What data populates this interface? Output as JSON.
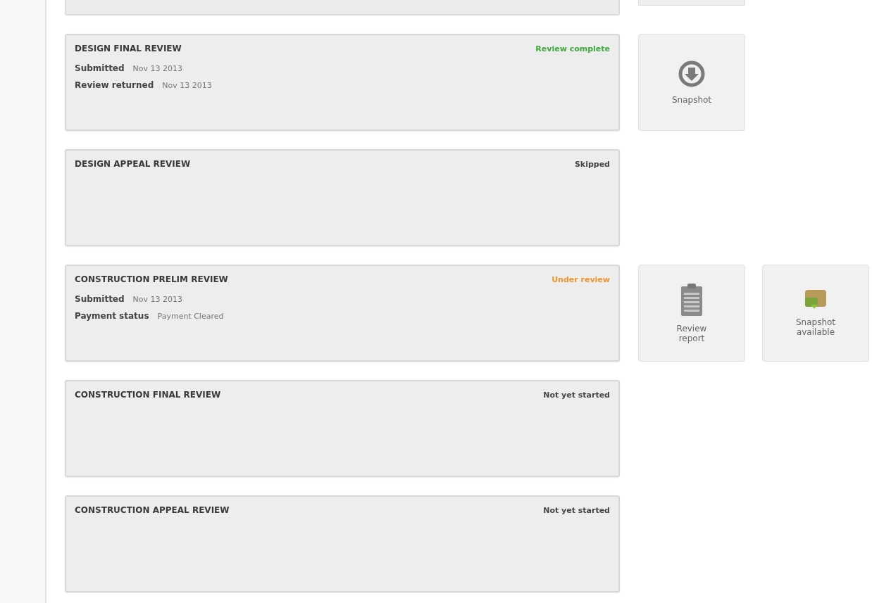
{
  "reviews": [
    {
      "title": "DESIGN FINAL REVIEW",
      "status": "Review complete",
      "color": "#3fa83f",
      "details": [
        {
          "label": "Submitted",
          "value": "Nov 13 2013"
        },
        {
          "label": "Review returned",
          "value": "Nov 13 2013"
        }
      ],
      "actions": [
        {
          "kind": "download",
          "label": "Snapshot"
        }
      ]
    },
    {
      "title": "DESIGN APPEAL REVIEW",
      "status": "Skipped",
      "color": "#444444"
    },
    {
      "title": "CONSTRUCTION PRELIM REVIEW",
      "status": "Under review",
      "color": "#f0932b",
      "details": [
        {
          "label": "Submitted",
          "value": "Nov 13 2013"
        },
        {
          "label": "Payment status",
          "value": "Payment Cleared"
        }
      ],
      "actions": [
        {
          "kind": "report",
          "label": "Review report"
        },
        {
          "kind": "snapshot",
          "label": "Snapshot available"
        }
      ]
    },
    {
      "title": "CONSTRUCTION FINAL REVIEW",
      "status": "Not yet started",
      "color": "#444444"
    },
    {
      "title": "CONSTRUCTION APPEAL REVIEW",
      "status": "Not yet started",
      "color": "#444444"
    }
  ]
}
